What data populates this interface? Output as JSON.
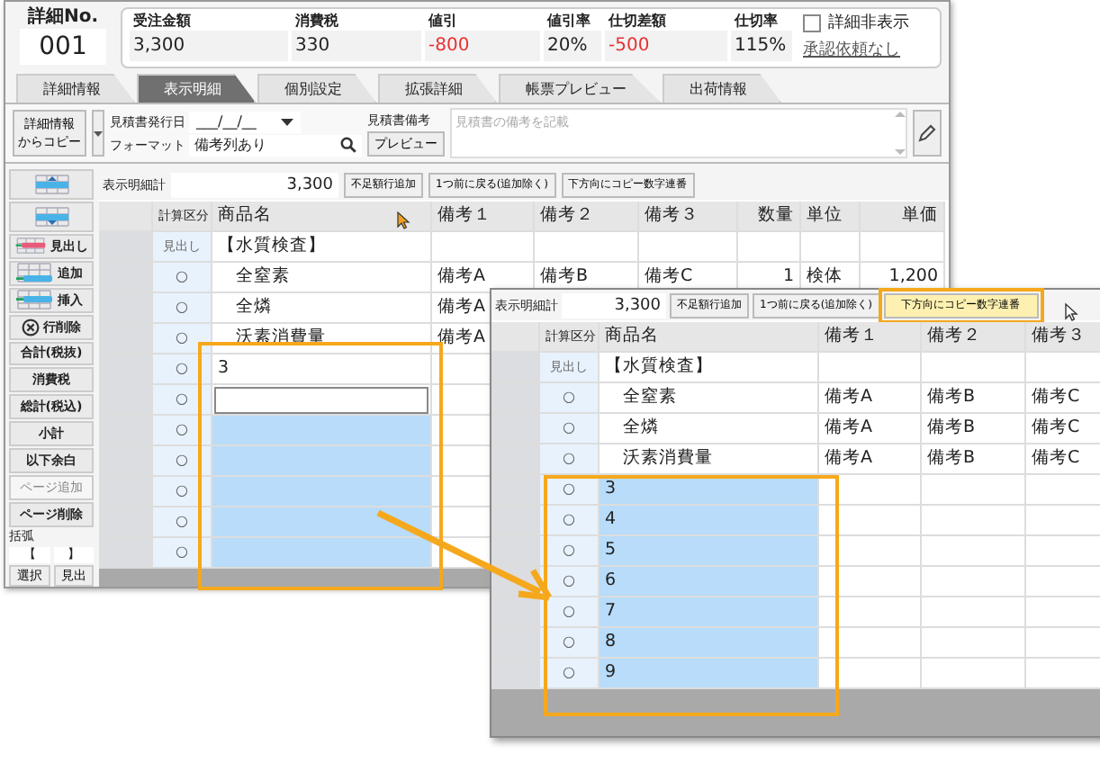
{
  "detail_no": {
    "label": "詳細No.",
    "value": "001"
  },
  "summary": [
    {
      "label": "受注金額",
      "value": "3,300",
      "negative": false
    },
    {
      "label": "消費税",
      "value": "330",
      "negative": false
    },
    {
      "label": "値引",
      "value": "-800",
      "negative": true
    },
    {
      "label": "値引率",
      "value": "20%",
      "negative": false
    },
    {
      "label": "仕切差額",
      "value": "-500",
      "negative": true
    },
    {
      "label": "仕切率",
      "value": "115%",
      "negative": false
    }
  ],
  "hide_detail": {
    "label": "詳細非表示",
    "checked": false
  },
  "approval_link": "承認依頼なし",
  "tabs": [
    {
      "label": "詳細情報",
      "selected": false
    },
    {
      "label": "表示明細",
      "selected": true
    },
    {
      "label": "個別設定",
      "selected": false
    },
    {
      "label": "拡張詳細",
      "selected": false
    },
    {
      "label": "帳票プレビュー",
      "selected": false
    },
    {
      "label": "出荷情報",
      "selected": false
    }
  ],
  "toolbar": {
    "copy_button": [
      "詳細情報",
      "からコピー"
    ],
    "issue_date": {
      "label": "見積書発行日",
      "value": "___/__/__"
    },
    "format": {
      "label": "フォーマット",
      "value": "備考列あり"
    },
    "memo": {
      "label": "見積書備考",
      "placeholder": "見積書の備考を記載"
    },
    "preview_button": "プレビュー"
  },
  "sidebar": {
    "items": [
      {
        "kind": "up",
        "disabled": false
      },
      {
        "kind": "down",
        "disabled": false
      },
      {
        "kind": "heading",
        "label": "見出し",
        "disabled": false
      },
      {
        "kind": "add",
        "label": "追加",
        "disabled": false
      },
      {
        "kind": "insert",
        "label": "挿入",
        "disabled": false
      },
      {
        "kind": "delete",
        "label": "行削除",
        "disabled": false
      },
      {
        "kind": "text",
        "label": "合計(税抜)",
        "disabled": false
      },
      {
        "kind": "text",
        "label": "消費税",
        "disabled": false
      },
      {
        "kind": "text",
        "label": "総計(税込)",
        "disabled": false
      },
      {
        "kind": "text",
        "label": "小計",
        "disabled": false
      },
      {
        "kind": "text",
        "label": "以下余白",
        "disabled": false
      },
      {
        "kind": "text",
        "label": "ページ追加",
        "disabled": true
      },
      {
        "kind": "text",
        "label": "ページ削除",
        "disabled": false
      }
    ],
    "bracket": {
      "label": "括弧",
      "open": "【",
      "close": "】"
    },
    "buttons": [
      "選択",
      "見出"
    ]
  },
  "grids": [
    {
      "kind": "main",
      "total_label": "表示明細計",
      "total": "3,300",
      "buttons": [
        {
          "label": "不足額行追加",
          "highlighted": false
        },
        {
          "label": "1つ前に戻る(追加除く)",
          "highlighted": false
        },
        {
          "label": "下方向にコピー数字連番",
          "highlighted": false
        }
      ],
      "columns": [
        "計算区分",
        "商品名",
        "備考１",
        "備考２",
        "備考３",
        "数量",
        "単位",
        "単価"
      ],
      "rows": [
        {
          "cells": [
            "見出し",
            "【水質検査】"
          ],
          "selected": false,
          "editing": false
        },
        {
          "cells": [
            "○",
            "　全窒素",
            "備考A",
            "備考B",
            "備考C",
            "1",
            "検体",
            "1,200"
          ],
          "selected": false,
          "editing": false
        },
        {
          "cells": [
            "○",
            "　全燐",
            "備考A"
          ],
          "selected": false,
          "editing": false
        },
        {
          "cells": [
            "○",
            "　沃素消費量",
            "備考A"
          ],
          "selected": false,
          "editing": false
        },
        {
          "cells": [
            "○",
            "3"
          ],
          "selected": false,
          "editing": false
        },
        {
          "cells": [
            "○"
          ],
          "selected": false,
          "editing": true
        },
        {
          "cells": [
            "○"
          ],
          "selected": true,
          "editing": false
        },
        {
          "cells": [
            "○"
          ],
          "selected": true,
          "editing": false
        },
        {
          "cells": [
            "○"
          ],
          "selected": true,
          "editing": false
        },
        {
          "cells": [
            "○"
          ],
          "selected": true,
          "editing": false
        },
        {
          "cells": [
            "○"
          ],
          "selected": true,
          "editing": false
        }
      ]
    },
    {
      "kind": "inset",
      "total_label": "表示明細計",
      "total": "3,300",
      "buttons": [
        {
          "label": "不足額行追加",
          "highlighted": false
        },
        {
          "label": "1つ前に戻る(追加除く)",
          "highlighted": false
        },
        {
          "label": "下方向にコピー数字連番",
          "highlighted": true
        }
      ],
      "columns": [
        "計算区分",
        "商品名",
        "備考１",
        "備考２",
        "備考３"
      ],
      "rows": [
        {
          "cells": [
            "見出し",
            "【水質検査】"
          ],
          "selected": false,
          "editing": false
        },
        {
          "cells": [
            "○",
            "　全窒素",
            "備考A",
            "備考B",
            "備考C"
          ],
          "selected": false,
          "editing": false
        },
        {
          "cells": [
            "○",
            "　全燐",
            "備考A",
            "備考B",
            "備考C"
          ],
          "selected": false,
          "editing": false
        },
        {
          "cells": [
            "○",
            "　沃素消費量",
            "備考A",
            "備考B",
            "備考C"
          ],
          "selected": false,
          "editing": false
        },
        {
          "cells": [
            "○",
            "3"
          ],
          "selected": true,
          "editing": false
        },
        {
          "cells": [
            "○",
            "4"
          ],
          "selected": true,
          "editing": false
        },
        {
          "cells": [
            "○",
            "5"
          ],
          "selected": true,
          "editing": false
        },
        {
          "cells": [
            "○",
            "6"
          ],
          "selected": true,
          "editing": false
        },
        {
          "cells": [
            "○",
            "7"
          ],
          "selected": true,
          "editing": false
        },
        {
          "cells": [
            "○",
            "8"
          ],
          "selected": true,
          "editing": false
        },
        {
          "cells": [
            "○",
            "9"
          ],
          "selected": true,
          "editing": false
        }
      ]
    }
  ]
}
